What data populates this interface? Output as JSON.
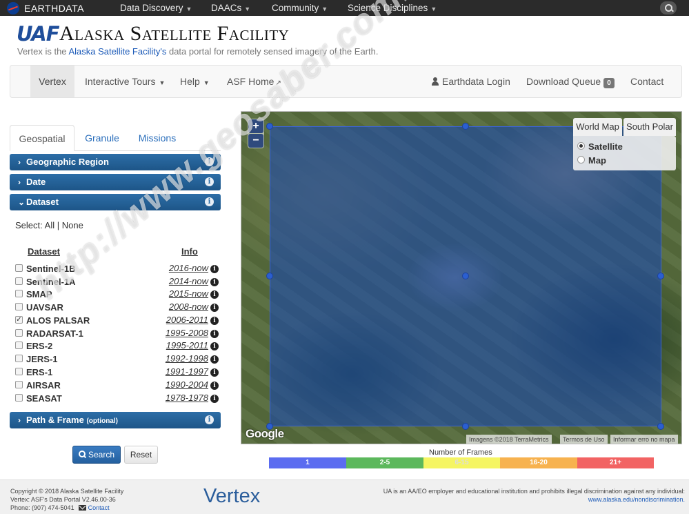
{
  "topbar": {
    "brand": "EARTHDATA",
    "menus": [
      {
        "label": "Data Discovery"
      },
      {
        "label": "DAACs"
      },
      {
        "label": "Community"
      },
      {
        "label": "Science Disciplines"
      }
    ]
  },
  "header": {
    "logo_uaf": "UAF",
    "title": "Alaska Satellite Facility",
    "tagline_prefix": "Vertex is the ",
    "tagline_link": "Alaska Satellite Facility's",
    "tagline_suffix": " data portal for remotely sensed imagery of the Earth."
  },
  "nav": {
    "vertex": "Vertex",
    "tours": "Interactive Tours",
    "help": "Help",
    "asf_home": "ASF Home",
    "login": "Earthdata Login",
    "queue": "Download Queue",
    "queue_count": "0",
    "contact": "Contact"
  },
  "tabs": [
    "Geospatial",
    "Granule",
    "Missions"
  ],
  "accordion": {
    "geographic_region": "Geographic Region",
    "date": "Date",
    "dataset": "Dataset",
    "path_frame": "Path & Frame",
    "path_frame_note": "(optional)"
  },
  "select": {
    "prefix": "Select:",
    "all": "All",
    "sep": "|",
    "none": "None"
  },
  "datasets": {
    "header_name": "Dataset",
    "header_info": "Info",
    "rows": [
      {
        "name": "Sentinel-1B",
        "range": "2016-now",
        "checked": false
      },
      {
        "name": "Sentinel-1A",
        "range": "2014-now",
        "checked": false
      },
      {
        "name": "SMAP",
        "range": "2015-now",
        "checked": false
      },
      {
        "name": "UAVSAR",
        "range": "2008-now",
        "checked": false
      },
      {
        "name": "ALOS PALSAR",
        "range": "2006-2011",
        "checked": true
      },
      {
        "name": "RADARSAT-1",
        "range": "1995-2008",
        "checked": false
      },
      {
        "name": "ERS-2",
        "range": "1995-2011",
        "checked": false
      },
      {
        "name": "JERS-1",
        "range": "1992-1998",
        "checked": false
      },
      {
        "name": "ERS-1",
        "range": "1991-1997",
        "checked": false
      },
      {
        "name": "AIRSAR",
        "range": "1990-2004",
        "checked": false
      },
      {
        "name": "SEASAT",
        "range": "1978-1978",
        "checked": false
      }
    ]
  },
  "buttons": {
    "search": "Search",
    "reset": "Reset"
  },
  "map": {
    "zoom_in": "+",
    "zoom_out": "−",
    "tab_world": "World Map",
    "tab_polar": "South Polar",
    "layer_satellite": "Satellite",
    "layer_map": "Map",
    "selected_layer": "Satellite",
    "google": "Google",
    "attrib_imagery": "Imagens ©2018 TerraMetrics",
    "attrib_terms": "Termos de Uso",
    "attrib_report": "Informar erro no mapa",
    "overlay_color": "#1446b9"
  },
  "legend": {
    "title": "Number of Frames",
    "bins": [
      {
        "label": "1",
        "color": "#5b6cf0"
      },
      {
        "label": "2-5",
        "color": "#5cb85c"
      },
      {
        "label": "6-15",
        "color": "#f5f562"
      },
      {
        "label": "16-20",
        "color": "#f7b24f"
      },
      {
        "label": "21+",
        "color": "#f26363"
      }
    ]
  },
  "footer": {
    "copyright": "Copyright © 2018 Alaska Satellite Facility",
    "version": "Vertex: ASF's Data Portal V2.46.00-36",
    "phone": "Phone: (907) 474-5041",
    "contact": "Contact",
    "brand": "Vertex",
    "disclaimer": "UA is an AA/EO employer and educational institution and prohibits illegal discrimination against any individual:",
    "link": "www.alaska.edu/nondiscrimination."
  },
  "watermark": "http://www.geosaber.com.br"
}
